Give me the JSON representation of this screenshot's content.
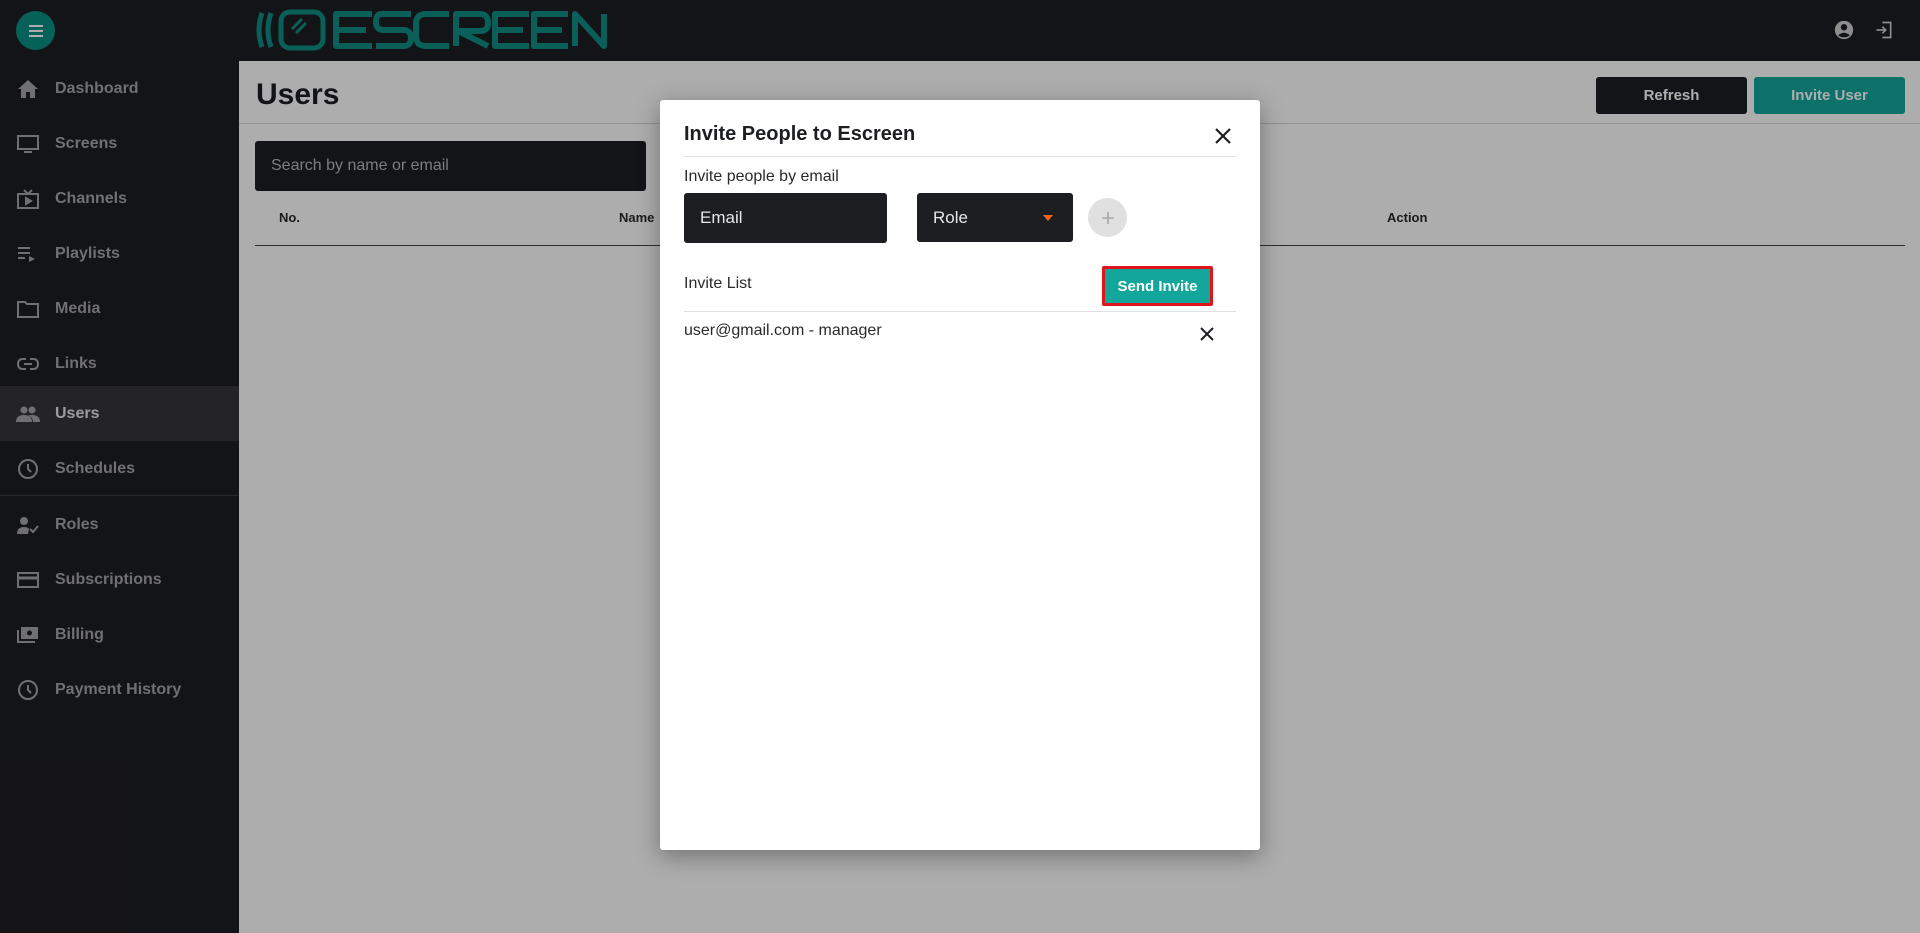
{
  "app": {
    "logo_text": "ESCREEN",
    "brand_color": "#12a79a",
    "dark_color": "#1d1e22",
    "icons": {
      "menu": "hamburger-icon",
      "account": "account-circle-icon",
      "logout": "logout-icon"
    }
  },
  "sidebar": {
    "items": [
      {
        "label": "Dashboard",
        "icon": "home-icon"
      },
      {
        "label": "Screens",
        "icon": "monitor-icon"
      },
      {
        "label": "Channels",
        "icon": "live-tv-icon"
      },
      {
        "label": "Playlists",
        "icon": "playlist-icon"
      },
      {
        "label": "Media",
        "icon": "folder-icon"
      },
      {
        "label": "Links",
        "icon": "link-icon"
      },
      {
        "label": "Users",
        "icon": "people-icon",
        "active": true
      },
      {
        "label": "Schedules",
        "icon": "clock-icon"
      },
      {
        "label": "Roles",
        "icon": "person-check-icon"
      },
      {
        "label": "Subscriptions",
        "icon": "card-icon"
      },
      {
        "label": "Billing",
        "icon": "payments-icon"
      },
      {
        "label": "Payment History",
        "icon": "history-clock-icon"
      }
    ]
  },
  "main": {
    "title": "Users",
    "refresh_label": "Refresh",
    "invite_label": "Invite User",
    "search_placeholder": "Search by name or email",
    "columns": [
      "No.",
      "Name",
      "Action"
    ]
  },
  "modal": {
    "title": "Invite People to Escreen",
    "invite_by_email_label": "Invite people by email",
    "email_placeholder": "Email",
    "role_value": "Role",
    "invite_list_label": "Invite List",
    "send_label": "Send Invite",
    "invites": [
      "user@gmail.com - manager"
    ]
  }
}
